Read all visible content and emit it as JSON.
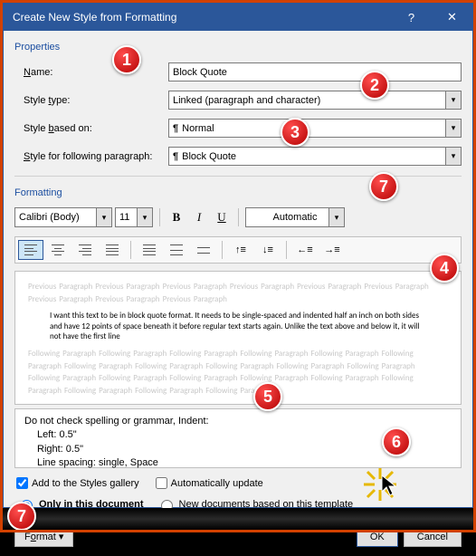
{
  "titlebar": {
    "title": "Create New Style from Formatting",
    "help": "?",
    "close": "✕"
  },
  "properties": {
    "header": "Properties",
    "name_label": "Name:",
    "name_value": "Block Quote",
    "type_label": "Style type:",
    "type_value": "Linked (paragraph and character)",
    "based_label": "Style based on:",
    "based_value": "Normal",
    "following_label": "Style for following paragraph:",
    "following_value": "Block Quote"
  },
  "formatting": {
    "header": "Formatting",
    "font_name": "Calibri (Body)",
    "font_size": "11",
    "color_label": "Automatic"
  },
  "preview": {
    "ghost_prev": "Previous Paragraph Previous Paragraph Previous Paragraph Previous Paragraph Previous Paragraph Previous Paragraph Previous Paragraph Previous Paragraph Previous Paragraph",
    "sample": "I want this text to be in block quote format. It needs to be single-spaced and indented half an inch on both sides and have 12 points of space beneath it before regular text starts again. Unlike the text above and below it, it will not have the first line",
    "ghost_next": "Following Paragraph Following Paragraph Following Paragraph Following Paragraph Following Paragraph Following Paragraph Following Paragraph Following Paragraph Following Paragraph Following Paragraph Following Paragraph Following Paragraph Following Paragraph Following Paragraph Following Paragraph Following Paragraph Following Paragraph Following Paragraph Following Paragraph Following Paragraph"
  },
  "description": {
    "line1": "Do not check spelling or grammar, Indent:",
    "line2": "Left:  0.5\"",
    "line3": "Right:  0.5\"",
    "line4": "Line spacing:  single, Space"
  },
  "options": {
    "add_gallery": "Add to the Styles gallery",
    "auto_update": "Automatically update",
    "only_doc": "Only in this document",
    "new_template": "New documents based on this template"
  },
  "buttons": {
    "format": "Format ▾",
    "ok": "OK",
    "cancel": "Cancel"
  },
  "markers": {
    "m1": "1",
    "m2": "2",
    "m3": "3",
    "m4": "4",
    "m5": "5",
    "m6": "6",
    "m7a": "7",
    "m7b": "7"
  }
}
